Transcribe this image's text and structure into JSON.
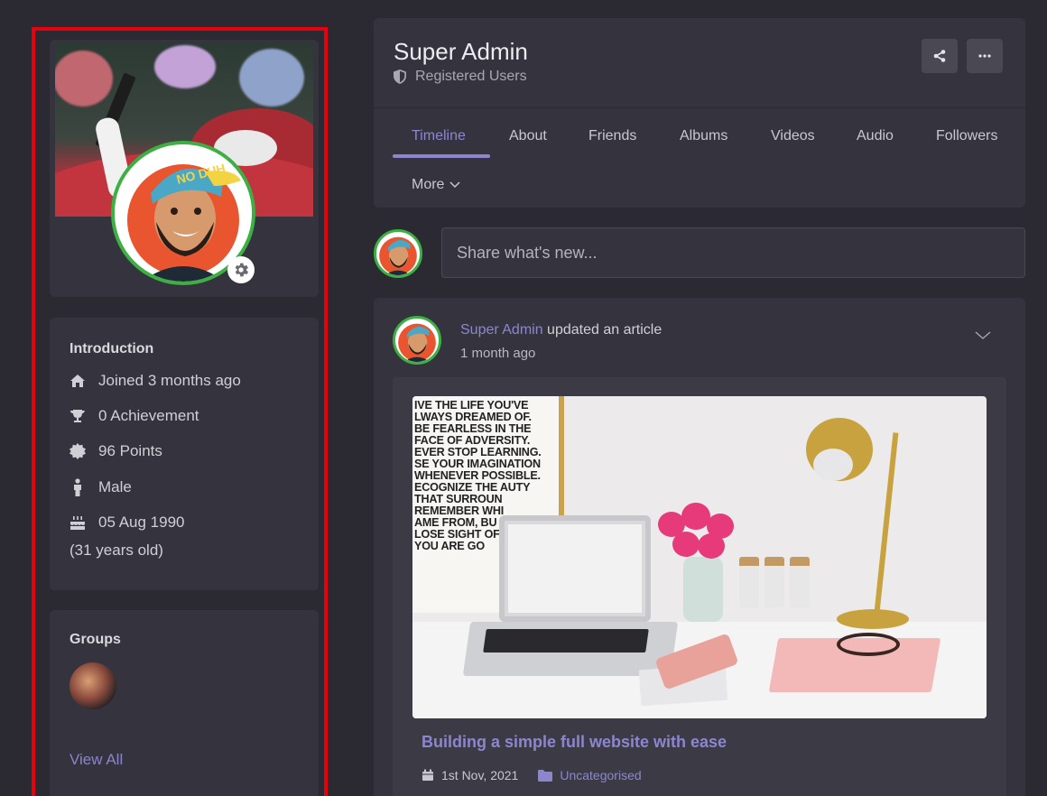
{
  "profile": {
    "name": "Super Admin",
    "role": "Registered Users"
  },
  "actions": {
    "share_icon": "share-icon",
    "more_icon": "ellipsis-icon"
  },
  "tabs": [
    {
      "label": "Timeline",
      "active": true
    },
    {
      "label": "About"
    },
    {
      "label": "Friends"
    },
    {
      "label": "Albums"
    },
    {
      "label": "Videos"
    },
    {
      "label": "Audio"
    },
    {
      "label": "Followers"
    },
    {
      "label": "More"
    }
  ],
  "composer": {
    "placeholder": "Share what's new..."
  },
  "sidebar": {
    "introduction": {
      "title": "Introduction",
      "items": [
        {
          "icon": "home-icon",
          "text": "Joined 3 months ago"
        },
        {
          "icon": "trophy-icon",
          "text": "0 Achievement"
        },
        {
          "icon": "badge-icon",
          "text": "96 Points"
        },
        {
          "icon": "male-icon",
          "text": "Male"
        },
        {
          "icon": "birthday-cake-icon",
          "text": "05 Aug 1990"
        }
      ],
      "age": "(31 years old)"
    },
    "groups": {
      "title": "Groups",
      "view_all": "View All"
    }
  },
  "post": {
    "author": "Super Admin",
    "action": " updated an article",
    "time": "1 month ago",
    "article": {
      "title": "Building a simple full website with ease",
      "date": "1st Nov, 2021",
      "category": "Uncategorised",
      "poster_lines": [
        "IVE THE LIFE YOU'VE",
        "LWAYS DREAMED OF.",
        "BE FEARLESS IN THE",
        "FACE OF ADVERSITY.",
        "EVER STOP LEARNING.",
        "SE YOUR IMAGINATION",
        "WHENEVER POSSIBLE.",
        "ECOGNIZE THE  AUTY",
        "THAT SURROUN",
        "REMEMBER WHI",
        "AME FROM, BU",
        "LOSE SIGHT OF",
        "YOU ARE GO"
      ]
    }
  },
  "colors": {
    "background": "#2b2a33",
    "panel": "#35343e",
    "accent": "#8c86cf",
    "online_ring": "#3cb043",
    "highlight_border": "#e8000d"
  }
}
